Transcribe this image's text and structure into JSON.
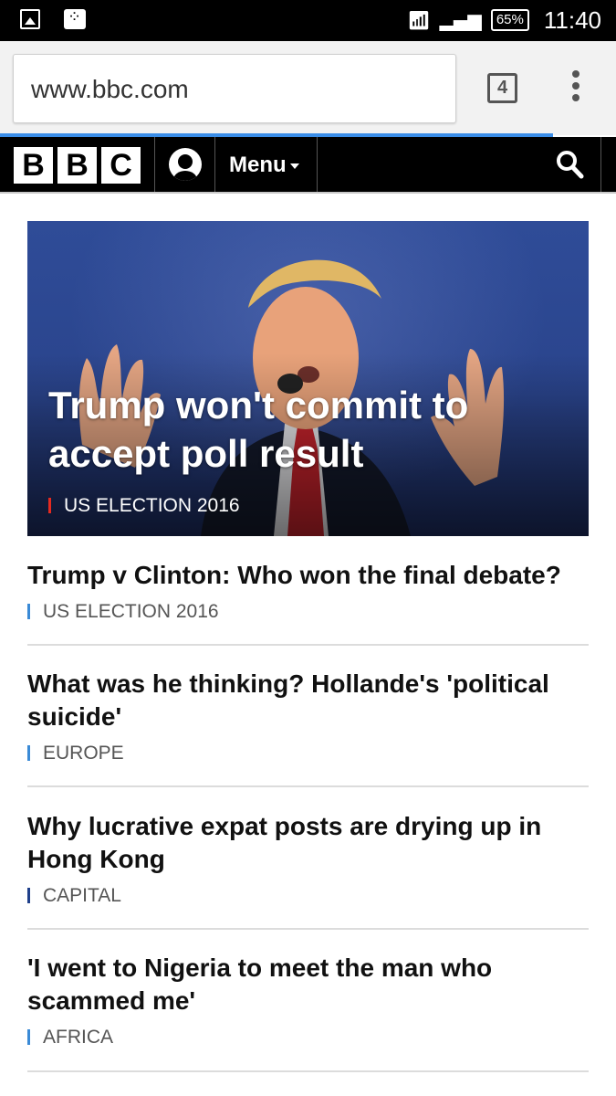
{
  "status_bar": {
    "battery": "65%",
    "time": "11:40"
  },
  "browser": {
    "url": "www.bbc.com",
    "tab_count": "4"
  },
  "nav": {
    "logo_letters": [
      "B",
      "B",
      "C"
    ],
    "menu_label": "Menu"
  },
  "hero": {
    "headline": "Trump won't commit to accept poll result",
    "tag": "US ELECTION 2016",
    "tag_color": "#e52a20"
  },
  "stories": [
    {
      "headline": "Trump v Clinton: Who won the final debate?",
      "tag": "US ELECTION 2016",
      "tag_color": "#3a8ad6"
    },
    {
      "headline": "What was he thinking? Hollande's 'political suicide'",
      "tag": "EUROPE",
      "tag_color": "#3a8ad6"
    },
    {
      "headline": "Why lucrative expat posts are drying up in Hong Kong",
      "tag": "CAPITAL",
      "tag_color": "#1f3f8a"
    },
    {
      "headline": "'I went to Nigeria to meet the man who scammed me'",
      "tag": "AFRICA",
      "tag_color": "#3a8ad6"
    }
  ]
}
